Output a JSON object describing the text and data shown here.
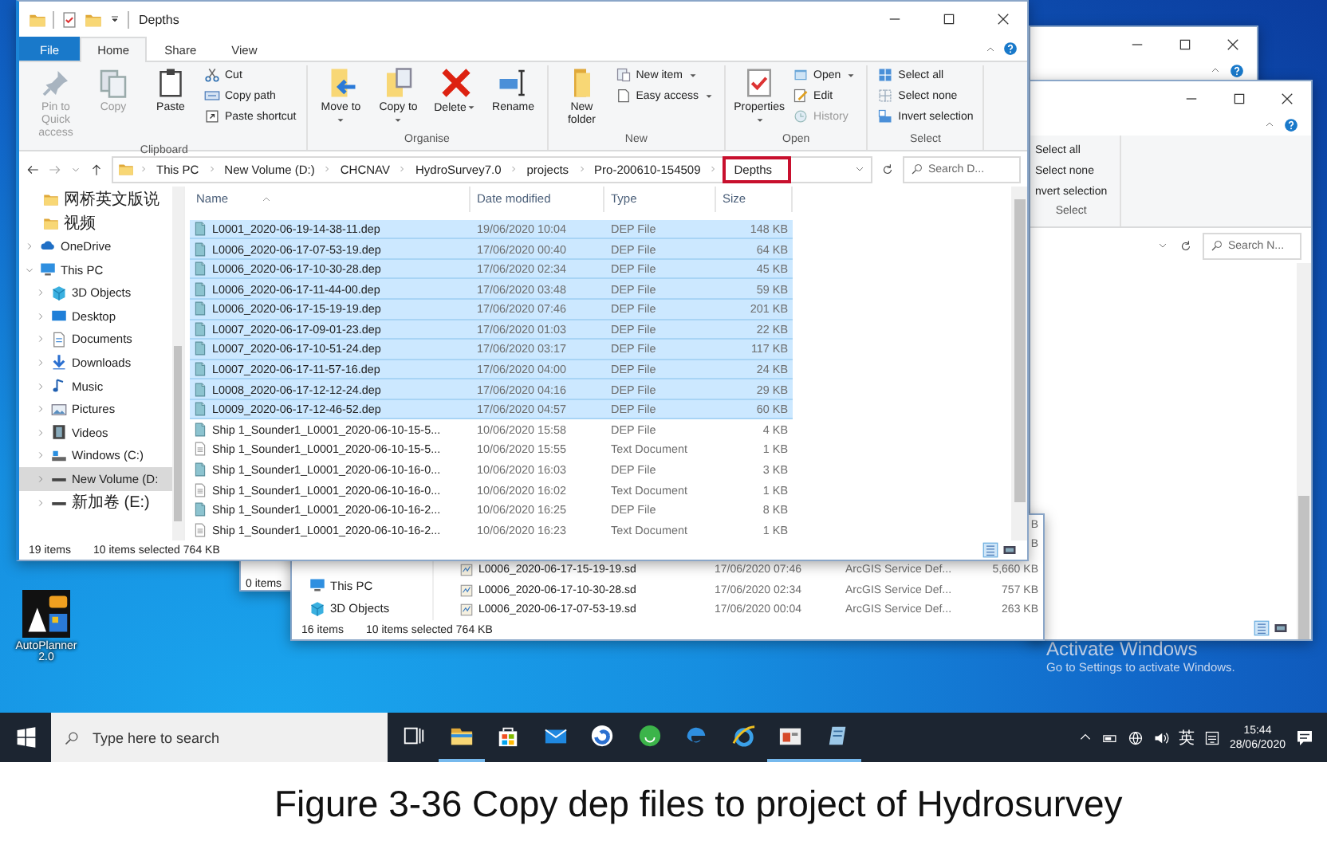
{
  "front_window": {
    "title": "Depths",
    "tabs": [
      {
        "label": "File",
        "kind": "file",
        "selected": false
      },
      {
        "label": "Home",
        "kind": "tab",
        "selected": true
      },
      {
        "label": "Share",
        "kind": "tab",
        "selected": false
      },
      {
        "label": "View",
        "kind": "tab",
        "selected": false
      }
    ],
    "ribbon_groups": [
      {
        "label": "Clipboard",
        "items": [
          {
            "label": "Pin to Quick access",
            "kind": "pin",
            "large": true,
            "dropdown": false,
            "disabled": true
          },
          {
            "label": "Copy",
            "kind": "copy",
            "large": true,
            "dropdown": false,
            "disabled": true
          },
          {
            "label": "Paste",
            "kind": "paste",
            "large": true,
            "dropdown": false,
            "disabled": false
          },
          {
            "label": "Cut",
            "kind": "cut",
            "large": false,
            "dropdown": false,
            "disabled": false
          },
          {
            "label": "Copy path",
            "kind": "copy-path",
            "large": false,
            "dropdown": false,
            "disabled": false
          },
          {
            "label": "Paste shortcut",
            "kind": "paste-shortcut",
            "large": false,
            "dropdown": false,
            "disabled": false
          }
        ]
      },
      {
        "label": "Organise",
        "items": [
          {
            "label": "Move to",
            "kind": "move",
            "large": true,
            "dropdown": true,
            "disabled": false
          },
          {
            "label": "Copy to",
            "kind": "copy-to",
            "large": true,
            "dropdown": true,
            "disabled": false
          },
          {
            "label": "Delete",
            "kind": "delete",
            "large": true,
            "dropdown": true,
            "disabled": false
          },
          {
            "label": "Rename",
            "kind": "rename",
            "large": true,
            "dropdown": false,
            "disabled": false
          }
        ]
      },
      {
        "label": "New",
        "items": [
          {
            "label": "New folder",
            "kind": "new-folder",
            "large": true,
            "dropdown": false,
            "disabled": false
          },
          {
            "label": "New item",
            "kind": "new-item",
            "large": false,
            "dropdown": true,
            "disabled": false
          },
          {
            "label": "Easy access",
            "kind": "easy-access",
            "large": false,
            "dropdown": true,
            "disabled": false
          }
        ]
      },
      {
        "label": "Open",
        "items": [
          {
            "label": "Properties",
            "kind": "properties",
            "large": true,
            "dropdown": true,
            "disabled": false
          },
          {
            "label": "Open",
            "kind": "open",
            "large": false,
            "dropdown": true,
            "disabled": false
          },
          {
            "label": "Edit",
            "kind": "edit",
            "large": false,
            "dropdown": false,
            "disabled": false
          },
          {
            "label": "History",
            "kind": "history",
            "large": false,
            "dropdown": false,
            "disabled": true
          }
        ]
      },
      {
        "label": "Select",
        "items": [
          {
            "label": "Select all",
            "kind": "select-all",
            "large": false,
            "dropdown": false,
            "disabled": false
          },
          {
            "label": "Select none",
            "kind": "select-none",
            "large": false,
            "dropdown": false,
            "disabled": false
          },
          {
            "label": "Invert selection",
            "kind": "invert",
            "large": false,
            "dropdown": false,
            "disabled": false
          }
        ]
      }
    ],
    "breadcrumbs": [
      {
        "label": "This PC",
        "highlighted": false
      },
      {
        "label": "New Volume (D:)",
        "highlighted": false
      },
      {
        "label": "CHCNAV",
        "highlighted": false
      },
      {
        "label": "HydroSurvey7.0",
        "highlighted": false
      },
      {
        "label": "projects",
        "highlighted": false
      },
      {
        "label": "Pro-200610-154509",
        "highlighted": false
      },
      {
        "label": "Depths",
        "highlighted": true
      }
    ],
    "search": {
      "placeholder": "Search D..."
    },
    "nav": [
      {
        "label": "网桥英文版说",
        "kind": "pinned",
        "selected": false
      },
      {
        "label": "视频",
        "kind": "pinned",
        "selected": false
      },
      {
        "label": "OneDrive",
        "kind": "cloud",
        "expanded": false,
        "selected": false
      },
      {
        "label": "This PC",
        "kind": "pc",
        "expanded": true,
        "selected": false,
        "children": [
          {
            "label": "3D Objects",
            "kind": "cube",
            "expanded": false,
            "selected": false
          },
          {
            "label": "Desktop",
            "kind": "desktop",
            "expanded": false,
            "selected": false
          },
          {
            "label": "Documents",
            "kind": "documents",
            "expanded": false,
            "selected": false
          },
          {
            "label": "Downloads",
            "kind": "downloads",
            "expanded": false,
            "selected": false
          },
          {
            "label": "Music",
            "kind": "music",
            "expanded": false,
            "selected": false
          },
          {
            "label": "Pictures",
            "kind": "pictures",
            "expanded": false,
            "selected": false
          },
          {
            "label": "Videos",
            "kind": "videos",
            "expanded": false,
            "selected": false
          },
          {
            "label": "Windows (C:)",
            "kind": "drive-c",
            "expanded": false,
            "selected": false
          },
          {
            "label": "New Volume (D:",
            "kind": "drive",
            "expanded": false,
            "selected": true
          },
          {
            "label": "新加卷 (E:)",
            "kind": "drive",
            "expanded": false,
            "selected": false
          }
        ]
      }
    ],
    "columns": [
      "Name",
      "Date modified",
      "Type",
      "Size"
    ],
    "rows": [
      {
        "name": "L0001_2020-06-19-14-38-11.dep",
        "date": "19/06/2020 10:04",
        "type": "DEP File",
        "size": "148 KB",
        "kind": "dep",
        "selected": true
      },
      {
        "name": "L0006_2020-06-17-07-53-19.dep",
        "date": "17/06/2020 00:40",
        "type": "DEP File",
        "size": "64 KB",
        "kind": "dep",
        "selected": true
      },
      {
        "name": "L0006_2020-06-17-10-30-28.dep",
        "date": "17/06/2020 02:34",
        "type": "DEP File",
        "size": "45 KB",
        "kind": "dep",
        "selected": true
      },
      {
        "name": "L0006_2020-06-17-11-44-00.dep",
        "date": "17/06/2020 03:48",
        "type": "DEP File",
        "size": "59 KB",
        "kind": "dep",
        "selected": true
      },
      {
        "name": "L0006_2020-06-17-15-19-19.dep",
        "date": "17/06/2020 07:46",
        "type": "DEP File",
        "size": "201 KB",
        "kind": "dep",
        "selected": true
      },
      {
        "name": "L0007_2020-06-17-09-01-23.dep",
        "date": "17/06/2020 01:03",
        "type": "DEP File",
        "size": "22 KB",
        "kind": "dep",
        "selected": true
      },
      {
        "name": "L0007_2020-06-17-10-51-24.dep",
        "date": "17/06/2020 03:17",
        "type": "DEP File",
        "size": "117 KB",
        "kind": "dep",
        "selected": true
      },
      {
        "name": "L0007_2020-06-17-11-57-16.dep",
        "date": "17/06/2020 04:00",
        "type": "DEP File",
        "size": "24 KB",
        "kind": "dep",
        "selected": true
      },
      {
        "name": "L0008_2020-06-17-12-12-24.dep",
        "date": "17/06/2020 04:16",
        "type": "DEP File",
        "size": "29 KB",
        "kind": "dep",
        "selected": true
      },
      {
        "name": "L0009_2020-06-17-12-46-52.dep",
        "date": "17/06/2020 04:57",
        "type": "DEP File",
        "size": "60 KB",
        "kind": "dep",
        "selected": true
      },
      {
        "name": "Ship 1_Sounder1_L0001_2020-06-10-15-5...",
        "date": "10/06/2020 15:58",
        "type": "DEP File",
        "size": "4 KB",
        "kind": "dep",
        "selected": false
      },
      {
        "name": "Ship 1_Sounder1_L0001_2020-06-10-15-5...",
        "date": "10/06/2020 15:55",
        "type": "Text Document",
        "size": "1 KB",
        "kind": "text",
        "selected": false
      },
      {
        "name": "Ship 1_Sounder1_L0001_2020-06-10-16-0...",
        "date": "10/06/2020 16:03",
        "type": "DEP File",
        "size": "3 KB",
        "kind": "dep",
        "selected": false
      },
      {
        "name": "Ship 1_Sounder1_L0001_2020-06-10-16-0...",
        "date": "10/06/2020 16:02",
        "type": "Text Document",
        "size": "1 KB",
        "kind": "text",
        "selected": false
      },
      {
        "name": "Ship 1_Sounder1_L0001_2020-06-10-16-2...",
        "date": "10/06/2020 16:25",
        "type": "DEP File",
        "size": "8 KB",
        "kind": "dep",
        "selected": false
      },
      {
        "name": "Ship 1_Sounder1_L0001_2020-06-10-16-2...",
        "date": "10/06/2020 16:23",
        "type": "Text Document",
        "size": "1 KB",
        "kind": "text",
        "selected": false
      }
    ],
    "status": {
      "count": "19 items",
      "selected": "10 items selected",
      "size": "764 KB"
    }
  },
  "small_window": {
    "status": "0 items"
  },
  "middle_window": {
    "size_fragments": [
      "B",
      "B"
    ],
    "nav": [
      {
        "label": "This PC",
        "kind": "pc"
      },
      {
        "label": "3D Objects",
        "kind": "cube"
      }
    ],
    "rows": [
      {
        "name": "L0006_2020-06-17-15-19-19.sd",
        "date": "17/06/2020 07:46",
        "type": "ArcGIS Service Def...",
        "size": "5,660 KB"
      },
      {
        "name": "L0006_2020-06-17-10-30-28.sd",
        "date": "17/06/2020 02:34",
        "type": "ArcGIS Service Def...",
        "size": "757 KB"
      },
      {
        "name": "L0006_2020-06-17-07-53-19.sd",
        "date": "17/06/2020 00:04",
        "type": "ArcGIS Service Def...",
        "size": "263 KB"
      }
    ],
    "status": {
      "count": "16 items",
      "selected": "10 items selected",
      "size": "764 KB"
    }
  },
  "back_window": {
    "select_items": [
      {
        "label": "Select all"
      },
      {
        "label": "Select none"
      },
      {
        "label": "nvert selection"
      }
    ],
    "group_label": "Select",
    "search": {
      "placeholder": "Search N..."
    }
  },
  "desktop": {
    "icon_label": "AutoPlanner 2.0",
    "notice_title": "Activate Windows",
    "notice_text": "Go to Settings to activate Windows."
  },
  "taskbar": {
    "search": {
      "placeholder": "Type here to search"
    },
    "apps": [
      {
        "kind": "task-view",
        "open": false
      },
      {
        "kind": "explorer",
        "open": true
      },
      {
        "kind": "store",
        "open": false
      },
      {
        "kind": "mail",
        "open": false
      },
      {
        "kind": "swirl",
        "open": false
      },
      {
        "kind": "smiley",
        "open": false
      },
      {
        "kind": "edge",
        "open": false
      },
      {
        "kind": "ie",
        "open": false
      },
      {
        "kind": "slides",
        "open": true
      },
      {
        "kind": "notepad",
        "open": true
      }
    ],
    "ime": "英",
    "time": "15:44",
    "date": "28/06/2020"
  },
  "caption": "Figure 3-36 Copy dep files to project of Hydrosurvey"
}
